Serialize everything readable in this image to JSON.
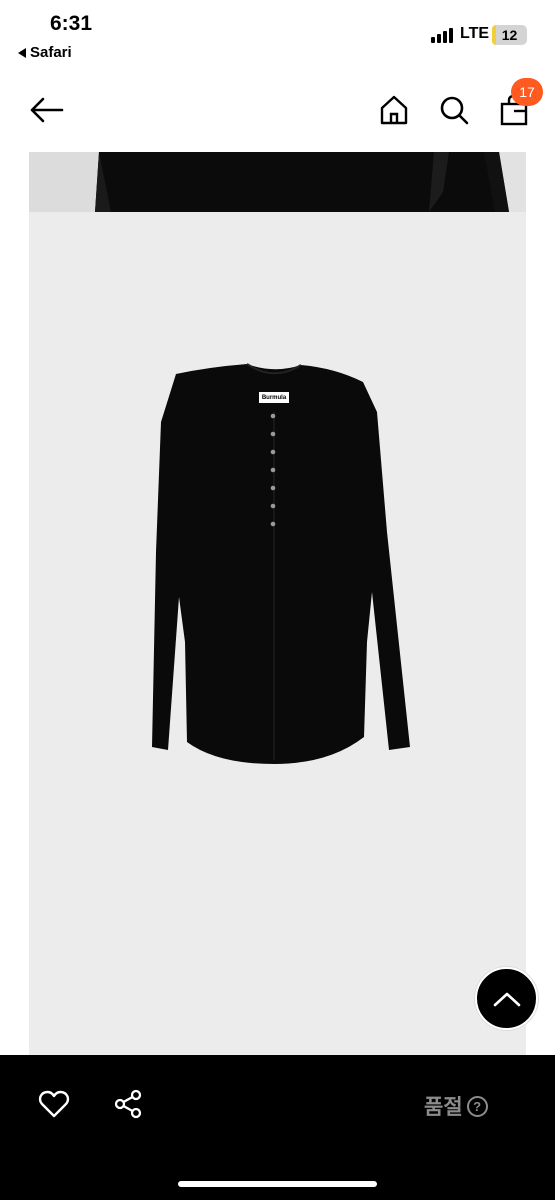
{
  "status_bar": {
    "time": "6:31",
    "back_app": "Safari",
    "network": "LTE",
    "battery": "12",
    "battery_level": 0.12
  },
  "nav": {
    "cart_count": "17"
  },
  "product": {
    "brand_tag": "Burmula"
  },
  "bottom_bar": {
    "status_label": "품절",
    "help_icon": "?"
  },
  "colors": {
    "badge": "#ff5a1f",
    "image_bg": "#ececec",
    "bottom_bar": "#000000",
    "muted_text": "#8c8c8c"
  }
}
